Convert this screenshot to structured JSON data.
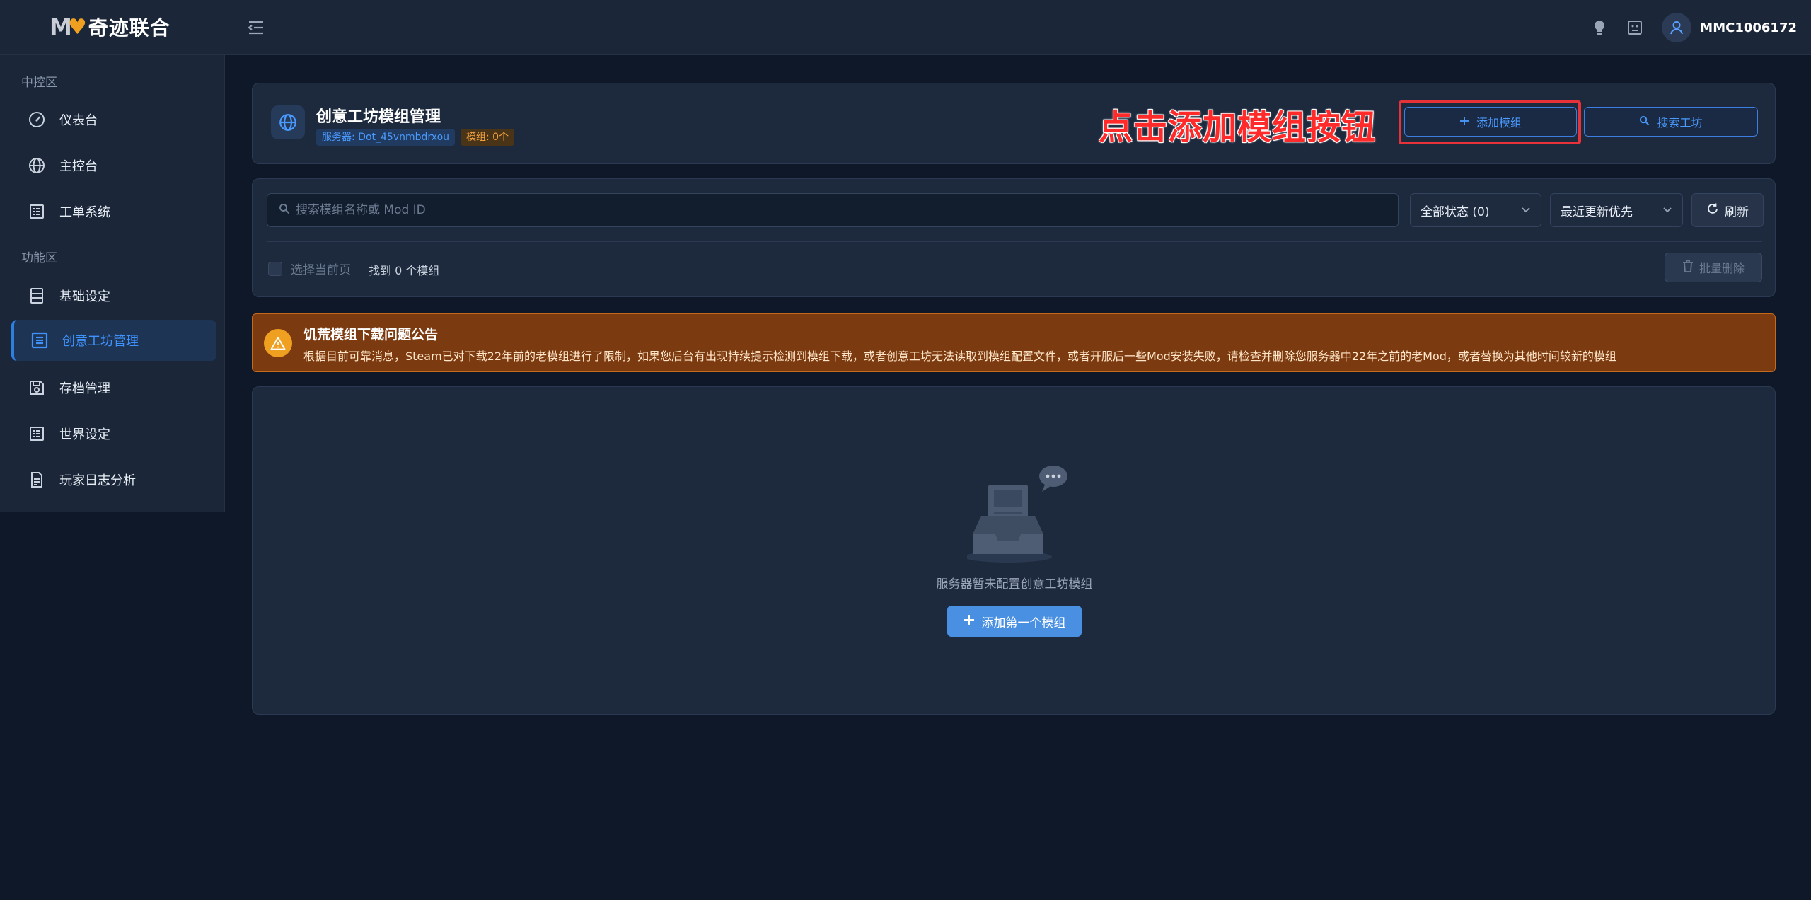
{
  "app": {
    "logo_mark": "M",
    "logo_heart": "♥",
    "logo_text": "奇迹联合",
    "username": "MMC1006172"
  },
  "sidebar": {
    "section_control": "中控区",
    "section_function": "功能区",
    "items": [
      {
        "label": "仪表台",
        "icon": "gauge-icon"
      },
      {
        "label": "主控台",
        "icon": "globe-icon"
      },
      {
        "label": "工单系统",
        "icon": "list-icon"
      },
      {
        "label": "基础设定",
        "icon": "server-icon"
      },
      {
        "label": "创意工坊管理",
        "icon": "workshop-icon",
        "active": true
      },
      {
        "label": "存档管理",
        "icon": "save-icon"
      },
      {
        "label": "世界设定",
        "icon": "list-icon"
      },
      {
        "label": "玩家日志分析",
        "icon": "file-icon"
      }
    ]
  },
  "header": {
    "title": "创意工坊模组管理",
    "server_tag": "服务器: Dot_45vnmbdrxou",
    "mod_count_tag": "模组: 0个",
    "annotation": "点击添加模组按钮",
    "add_mod_label": "添加模组",
    "search_workshop_label": "搜索工坊"
  },
  "filter": {
    "search_placeholder": "搜索模组名称或 Mod ID",
    "status_select": "全部状态 (0)",
    "sort_select": "最近更新优先",
    "refresh_label": "刷新",
    "select_page_label": "选择当前页",
    "found_text": "找到 0 个模组",
    "bulk_delete_label": "批量删除"
  },
  "notice": {
    "title": "饥荒模组下载问题公告",
    "body": "根据目前可靠消息，Steam已对下载22年前的老模组进行了限制，如果您后台有出现持续提示检测到模组下载，或者创意工坊无法读取到模组配置文件，或者开服后一些Mod安装失败，请检查并删除您服务器中22年之前的老Mod，或者替换为其他时间较新的模组"
  },
  "empty": {
    "text": "服务器暂未配置创意工坊模组",
    "button_label": "添加第一个模组"
  },
  "colors": {
    "accent": "#3f93ff",
    "notice_bg": "#7c3a10",
    "annotation": "#ff2a2a"
  }
}
